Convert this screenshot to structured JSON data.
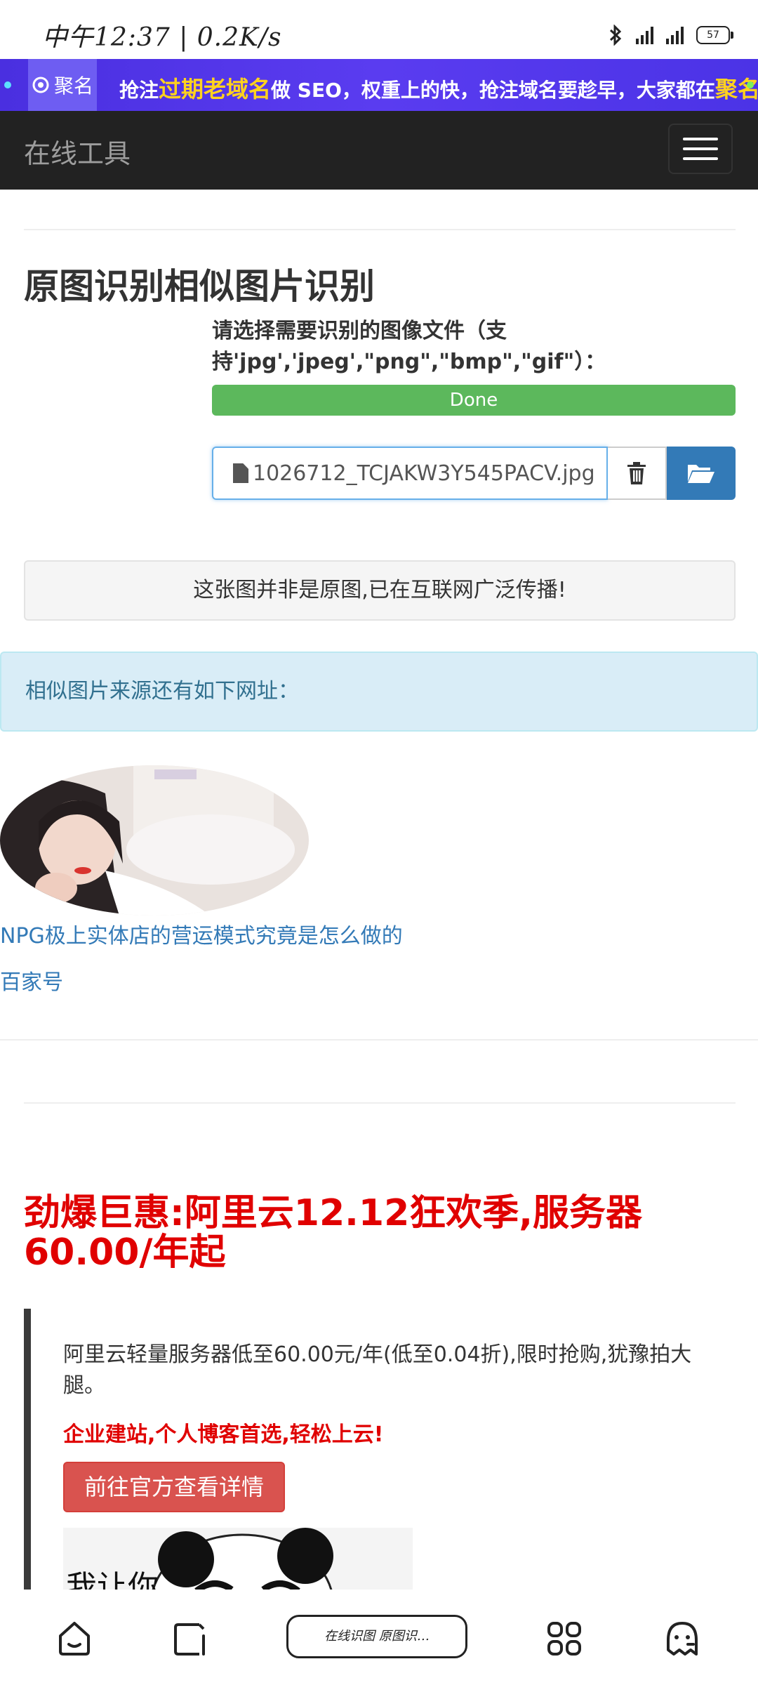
{
  "status_bar": {
    "time_text": "中午12:37 | 0.2K/s",
    "battery": "57"
  },
  "ad_banner": {
    "logo_text": "聚名",
    "text_part1": "抢注",
    "text_highlight1": "过期老域名",
    "text_part2": "做 SEO，权重上的快，抢注域名要趁早，大家都在",
    "text_highlight2": "聚名网",
    "text_part3": "！"
  },
  "navbar": {
    "brand": "在线工具"
  },
  "page": {
    "title": "原图识别相似图片识别",
    "upload_label": "请选择需要识别的图像文件（支持'jpg','jpeg',\"png\",\"bmp\",\"gif\"）：",
    "progress": {
      "label": "Done",
      "value": 100
    },
    "file_name": "1026712_TCJAKW3Y545PACV.jpg"
  },
  "result": {
    "message": "这张图并非是原图,已在互联网广泛传播!",
    "similar_heading": "相似图片来源还有如下网址：",
    "items": [
      {
        "title": "NPG极上实体店的营运模式究竟是怎么做的",
        "source": "百家号"
      }
    ]
  },
  "promo": {
    "title": "劲爆巨惠:阿里云12.12狂欢季,服务器60.00/年起",
    "description": "阿里云轻量服务器低至60.00元/年(低至0.04折),限时抢购,犹豫拍大腿。",
    "subtitle": "企业建站,个人博客首选,轻松上云!",
    "button": "前往官方查看详情",
    "meme_text": "我让你"
  },
  "bottom_nav": {
    "tab_label": "在线识图 原图识…",
    "icons": [
      "home-icon",
      "tabs-icon",
      "apps-icon",
      "assistant-icon"
    ]
  },
  "colors": {
    "navbar_bg": "#222222",
    "progress_success": "#5cb85c",
    "primary": "#337ab7",
    "danger": "#d9534f",
    "promo_red": "#e00000",
    "alert_info_bg": "#d9edf7"
  }
}
